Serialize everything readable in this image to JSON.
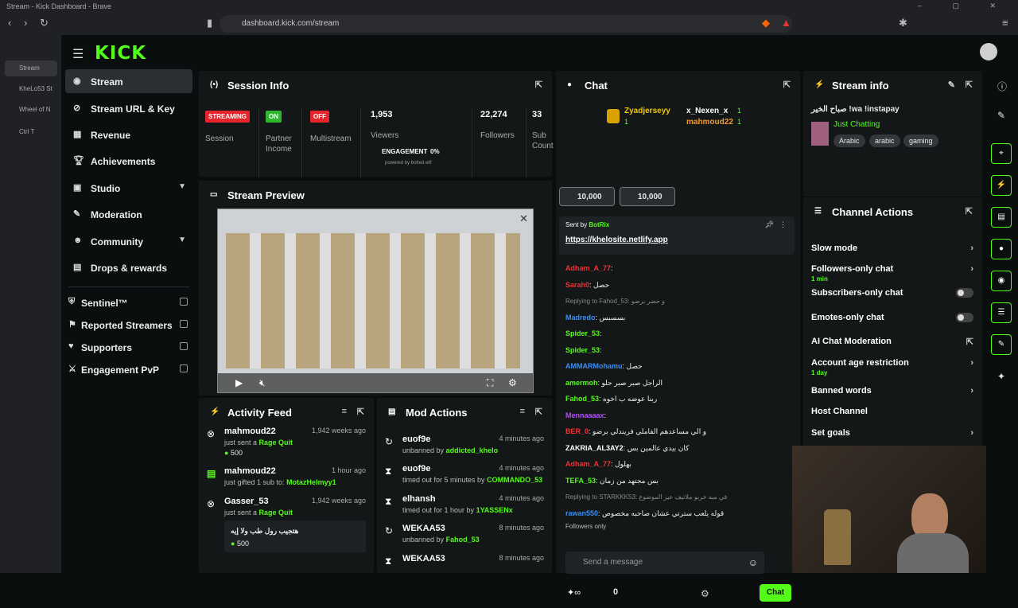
{
  "browser": {
    "title": "Stream - Kick Dashboard - Brave",
    "url": "dashboard.kick.com/stream",
    "tabs": [
      {
        "label": "Stream"
      },
      {
        "label": "KheLo53 St"
      },
      {
        "label": "Wheel of N"
      },
      {
        "label": "Ctrl  T"
      }
    ]
  },
  "app": {
    "logo": "KICK"
  },
  "sidebar": {
    "items": [
      {
        "label": "Stream",
        "icon": "broadcast-icon"
      },
      {
        "label": "Stream URL & Key",
        "icon": "link-icon"
      },
      {
        "label": "Revenue",
        "icon": "revenue-icon"
      },
      {
        "label": "Achievements",
        "icon": "trophy-icon"
      },
      {
        "label": "Studio",
        "icon": "studio-icon"
      },
      {
        "label": "Moderation",
        "icon": "wrench-icon"
      },
      {
        "label": "Community",
        "icon": "people-icon"
      },
      {
        "label": "Drops & rewards",
        "icon": "gift-icon"
      }
    ],
    "extensions": [
      {
        "label": "Sentinel™",
        "icon": "shield-icon"
      },
      {
        "label": "Reported Streamers",
        "icon": "flag-icon"
      },
      {
        "label": "Supporters",
        "icon": "heart-icon"
      },
      {
        "label": "Engagement PvP",
        "icon": "swords-icon"
      }
    ]
  },
  "session": {
    "title": "Session Info",
    "cols": [
      {
        "badge": "STREAMING",
        "label": "Session",
        "color": "#e5252b"
      },
      {
        "badge": "ON",
        "label": "Partner Income",
        "color": "#2eb82e"
      },
      {
        "badge": "OFF",
        "label": "Multistream",
        "color": "#e5252b"
      },
      {
        "value": "1,953",
        "label": "Viewers",
        "engagement_label": "ENGAGEMENT",
        "engagement_value": "0%",
        "powered": "powered by botted.wtf"
      },
      {
        "value": "22,274",
        "label": "Followers"
      },
      {
        "value": "33",
        "label": "Sub Count"
      }
    ]
  },
  "preview": {
    "title": "Stream Preview"
  },
  "activity": {
    "title": "Activity Feed",
    "items": [
      {
        "name": "mahmoud22",
        "sub": "just sent a",
        "action": "Rage Quit",
        "amount": "500",
        "time": "1,942 weeks ago"
      },
      {
        "name": "mahmoud22",
        "sub": "just gifted 1 sub to:",
        "action": "MotazHelmyy1",
        "time": "1 hour ago"
      },
      {
        "name": "Gasser_53",
        "sub": "just sent a",
        "action": "Rage Quit",
        "time": "1,942 weeks ago",
        "message": "هتجيب رول طب ولا إيه",
        "amount": "500"
      }
    ]
  },
  "modactions": {
    "title": "Mod Actions",
    "items": [
      {
        "name": "euof9e",
        "sub": "unbanned by",
        "by": "addicted_khelo",
        "time": "4 minutes ago",
        "icon": "unban-icon"
      },
      {
        "name": "euof9e",
        "sub": "timed out for 5 minutes by",
        "by": "COMMANDO_53",
        "time": "4 minutes ago",
        "icon": "hourglass-icon"
      },
      {
        "name": "elhansh",
        "sub": "timed out for 1 hour by",
        "by": "1YASSENx",
        "time": "4 minutes ago",
        "icon": "hourglass-icon"
      },
      {
        "name": "WEKAA53",
        "sub": "unbanned by",
        "by": "Fahod_53",
        "time": "8 minutes ago",
        "icon": "unban-icon"
      },
      {
        "name": "WEKAA53",
        "sub": "",
        "by": "",
        "time": "8 minutes ago",
        "icon": "hourglass-icon"
      }
    ]
  },
  "chat": {
    "title": "Chat",
    "top": [
      {
        "name": "Zyadjerseyy",
        "count": "1"
      },
      {
        "name": "x_Nexen_x",
        "count": "1"
      },
      {
        "name": "mahmoud22",
        "count": "1"
      }
    ],
    "gifts": [
      "10,000",
      "10,000"
    ],
    "pinned": {
      "sent_by": "Sent by",
      "user": "BotRix",
      "link": "https://khelosite.netlify.app"
    },
    "lines": [
      {
        "user": "Adham_A_77",
        "text": "",
        "color": "#e33"
      },
      {
        "user": "Sarah0",
        "text": "حصل",
        "color": "#e33"
      },
      {
        "user": "",
        "text": "Replying to Fahod_53: و حضر برضو",
        "color": "#888"
      },
      {
        "user": "Madredo",
        "text": "بسسبس",
        "color": "#3a8ef5"
      },
      {
        "user": "Spider_53",
        "text": "",
        "color": "#53fc18"
      },
      {
        "user": "Spider_53",
        "text": "",
        "color": "#53fc18"
      },
      {
        "user": "AMMARMohamu",
        "text": "حصل",
        "color": "#3a8ef5"
      },
      {
        "user": "amermoh",
        "text": "الراجل صبر صبر حلو",
        "color": "#53fc18"
      },
      {
        "user": "Fahod_53",
        "text": "ربنا عوضه ب اخوه",
        "color": "#53fc18"
      },
      {
        "user": "Mennaaaax",
        "text": "",
        "color": "#b04cff"
      },
      {
        "user": "BER_0",
        "text": "و الي مساعدهم الفاملي فريندلي برضو",
        "color": "#e33"
      },
      {
        "user": "ZAKRIA_AL3AY2",
        "text": "كان بيدي عالمين بس",
        "color": "#fff"
      },
      {
        "user": "Adham_A_77",
        "text": "بهلول",
        "color": "#e33"
      },
      {
        "user": "TEFA_53",
        "text": "بس مجتهد من زمان",
        "color": "#53fc18"
      },
      {
        "user": "",
        "text": "Replying to STARKKK53: في مبه خربو ملاتيف عيز الموضوع",
        "color": "#888"
      },
      {
        "user": "rawan550",
        "text": "قوله يلعب سترتي عشان صاحبه مخصوص",
        "color": "#3a8ef5"
      }
    ],
    "followers_only": "Followers only",
    "placeholder": "Send a message",
    "count": "0",
    "send": "Chat"
  },
  "streaminfo": {
    "title": "Stream info",
    "stream_title": "صباح الخير !wa !instapay",
    "category": "Just Chatting",
    "tags": [
      "Arabic",
      "arabic",
      "gaming"
    ]
  },
  "channelactions": {
    "title": "Channel Actions",
    "rows": [
      {
        "label": "Slow mode",
        "kind": "chev"
      },
      {
        "label": "Followers-only chat",
        "sub": "1 min",
        "kind": "chev"
      },
      {
        "label": "Subscribers-only chat",
        "kind": "toggle"
      },
      {
        "label": "Emotes-only chat",
        "kind": "toggle"
      },
      {
        "label": "AI Chat Moderation",
        "kind": "link"
      },
      {
        "label": "Account age restriction",
        "sub": "1 day",
        "kind": "chev"
      },
      {
        "label": "Banned words",
        "kind": "chev"
      },
      {
        "label": "Host Channel",
        "kind": "none"
      },
      {
        "label": "Set goals",
        "kind": "chev"
      }
    ]
  },
  "colors": {
    "accent": "#53fc18",
    "panel": "#141718",
    "bg": "#0b0e0f"
  }
}
